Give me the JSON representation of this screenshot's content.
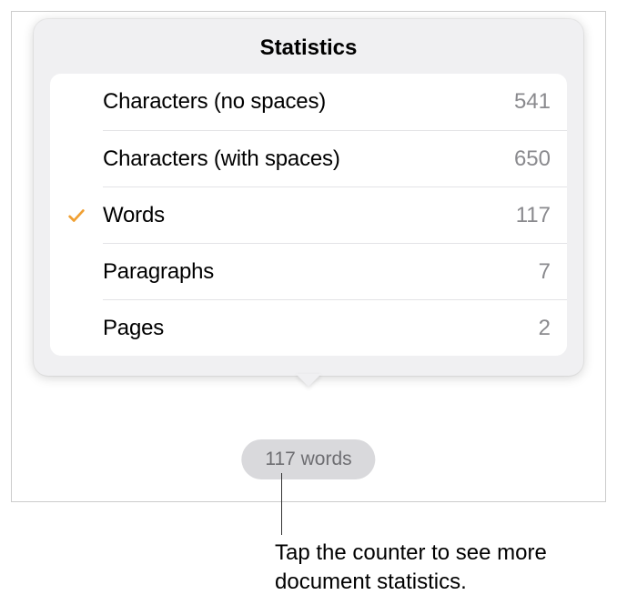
{
  "popover": {
    "title": "Statistics"
  },
  "stats": [
    {
      "label": "Characters (no spaces)",
      "value": "541",
      "checked": false
    },
    {
      "label": "Characters (with spaces)",
      "value": "650",
      "checked": false
    },
    {
      "label": "Words",
      "value": "117",
      "checked": true
    },
    {
      "label": "Paragraphs",
      "value": "7",
      "checked": false
    },
    {
      "label": "Pages",
      "value": "2",
      "checked": false
    }
  ],
  "counter": {
    "label": "117 words"
  },
  "callout": {
    "text": "Tap the counter to see more document statistics."
  }
}
